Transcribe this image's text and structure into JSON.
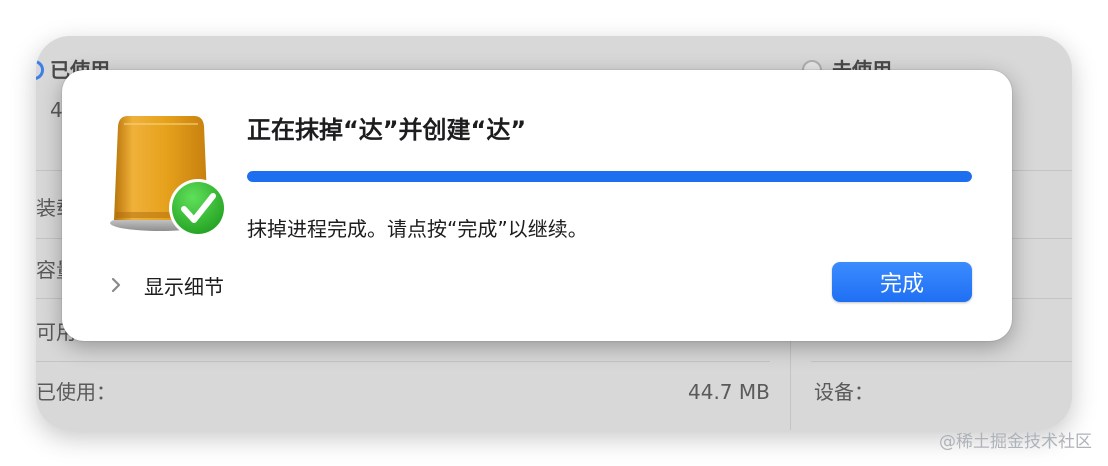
{
  "background_window": {
    "used_legend_label": "已使用",
    "used_legend_value": "4",
    "free_legend_label": "未使用",
    "rows": [
      "装载",
      "容量",
      "可用"
    ],
    "used_label": "已使用：",
    "used_value": "44.7 MB",
    "device_label": "设备："
  },
  "sheet": {
    "title": "正在抹掉“达”并创建“达”",
    "progress": 1.0,
    "status": "抹掉进程完成。请点按“完成”以继续。",
    "details_label": "显示细节",
    "done_label": "完成",
    "icons": {
      "disk": "external-disk-icon",
      "badge": "checkmark-badge-icon",
      "chevron": "chevron-right-icon"
    }
  },
  "colors": {
    "accent": "#1e6ff0",
    "disk": "#e6a21c",
    "check": "#2fb42a"
  },
  "watermark": "@稀土掘金技术社区"
}
